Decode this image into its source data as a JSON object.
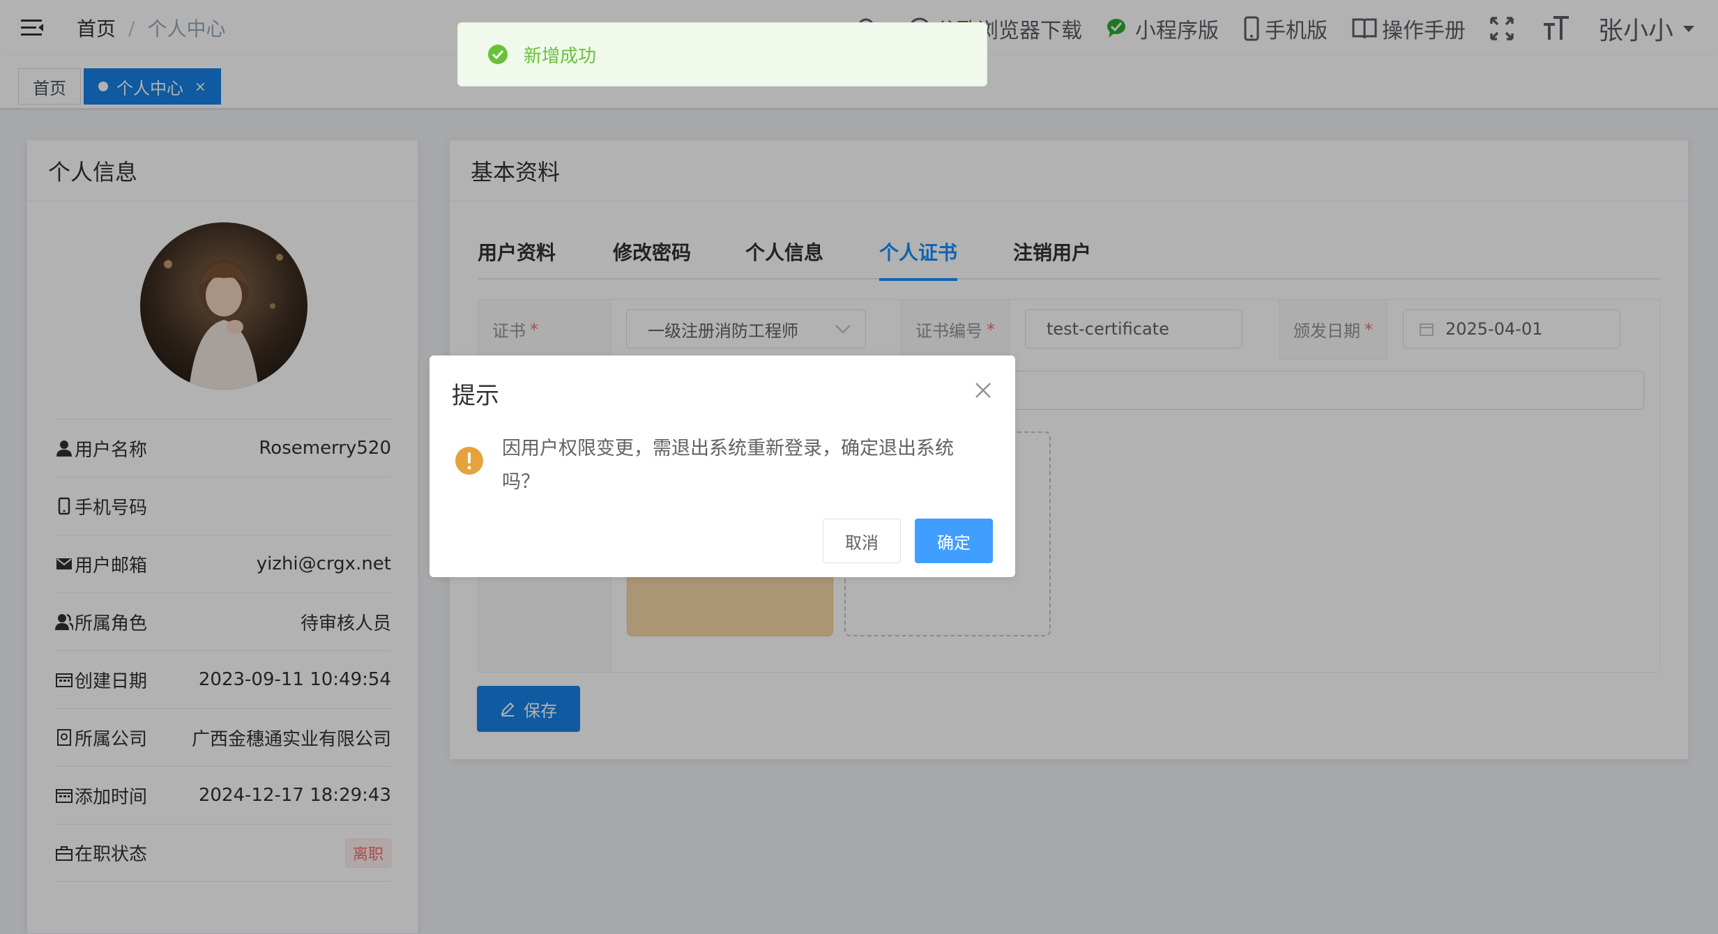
{
  "header": {
    "breadcrumb": {
      "home": "首页",
      "separator": "/",
      "current": "个人中心"
    },
    "menu": {
      "browser_download": "谷歌浏览器下载",
      "mini_program": "小程序版",
      "mobile": "手机版",
      "manual": "操作手册",
      "user_name": "张小小"
    }
  },
  "tags": {
    "home": "首页",
    "current": "个人中心",
    "close": "×"
  },
  "left_card": {
    "title": "个人信息",
    "rows": [
      {
        "label": "用户名称",
        "value": "Rosemerry520"
      },
      {
        "label": "手机号码",
        "value": ""
      },
      {
        "label": "用户邮箱",
        "value": "yizhi@crgx.net"
      },
      {
        "label": "所属角色",
        "value": "待审核人员"
      },
      {
        "label": "创建日期",
        "value": "2023-09-11 10:49:54"
      },
      {
        "label": "所属公司",
        "value": "广西金穗通实业有限公司"
      },
      {
        "label": "添加时间",
        "value": "2024-12-17 18:29:43"
      },
      {
        "label": "在职状态",
        "value": "离职"
      }
    ]
  },
  "right_card": {
    "title": "基本资料",
    "tabs": [
      "用户资料",
      "修改密码",
      "个人信息",
      "个人证书",
      "注销用户"
    ],
    "active_tab": "个人证书",
    "form": {
      "cert_label": "证书",
      "cert_value": "一级注册消防工程师",
      "cert_no_label": "证书编号",
      "cert_no_value": "test-certificate",
      "issue_date_label": "颁发日期",
      "issue_date_value": "2025-04-01",
      "required_mark": "*"
    },
    "save_label": "保存"
  },
  "toast": {
    "message": "新增成功"
  },
  "dialog": {
    "title": "提示",
    "message": "因用户权限变更，需退出系统重新登录，确定退出系统吗？",
    "cancel": "取消",
    "confirm": "确定"
  },
  "colors": {
    "primary": "#1682e6",
    "dialog_primary": "#409eff",
    "success": "#67c23a",
    "warning": "#e6a23c",
    "danger": "#f56c6c"
  }
}
